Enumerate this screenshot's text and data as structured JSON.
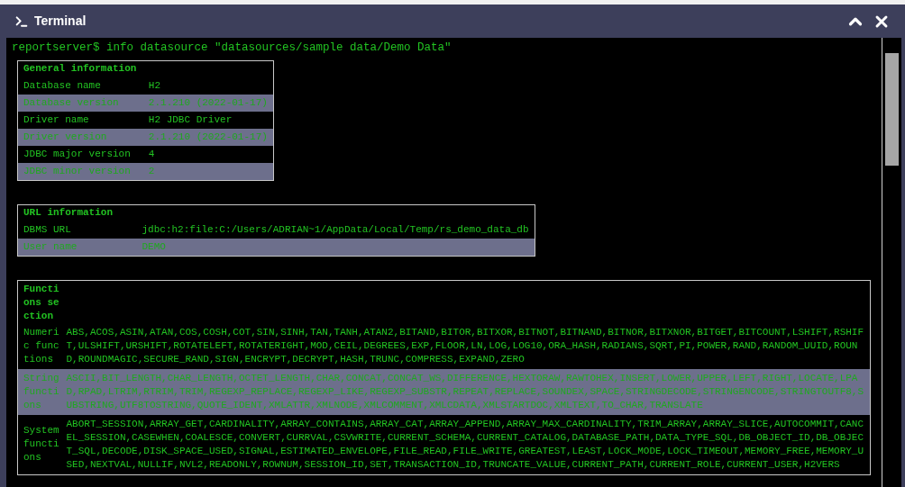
{
  "window": {
    "title": "Terminal"
  },
  "command": "reportserver$ info datasource \"datasources/sample data/Demo Data\"",
  "tables": [
    {
      "title": "General information",
      "rows": [
        {
          "label": "Database name",
          "value": "H2",
          "highlighted": false
        },
        {
          "label": "Database version",
          "value": "2.1.210 (2022-01-17)",
          "highlighted": true
        },
        {
          "label": "Driver name",
          "value": "H2 JDBC Driver",
          "highlighted": false
        },
        {
          "label": "Driver version",
          "value": "2.1.210 (2022-01-17)",
          "highlighted": true
        },
        {
          "label": "JDBC major version",
          "value": "4",
          "highlighted": false
        },
        {
          "label": "JDBC minor version",
          "value": "2",
          "highlighted": true
        }
      ]
    },
    {
      "title": "URL information",
      "rows": [
        {
          "label": "DBMS URL",
          "value": "jdbc:h2:file:C:/Users/ADRIAN~1/AppData/Local/Temp/rs_demo_data_db",
          "highlighted": false
        },
        {
          "label": "User name",
          "value": "DEMO",
          "highlighted": true
        }
      ]
    }
  ],
  "functions_table": {
    "title": "Functions section",
    "rows": [
      {
        "label": "Numeric functions",
        "value": "ABS,ACOS,ASIN,ATAN,COS,COSH,COT,SIN,SINH,TAN,TANH,ATAN2,BITAND,BITOR,BITXOR,BITNOT,BITNAND,BITNOR,BITXNOR,BITGET,BITCOUNT,LSHIFT,RSHIFT,ULSHIFT,URSHIFT,ROTATELEFT,ROTATERIGHT,MOD,CEIL,DEGREES,EXP,FLOOR,LN,LOG,LOG10,ORA_HASH,RADIANS,SQRT,PI,POWER,RAND,RANDOM_UUID,ROUND,ROUNDMAGIC,SECURE_RAND,SIGN,ENCRYPT,DECRYPT,HASH,TRUNC,COMPRESS,EXPAND,ZERO",
        "highlighted": false
      },
      {
        "label": "String functions",
        "value": "ASCII,BIT_LENGTH,CHAR_LENGTH,OCTET_LENGTH,CHAR,CONCAT,CONCAT_WS,DIFFERENCE,HEXTORAW,RAWTOHEX,INSERT,LOWER,UPPER,LEFT,RIGHT,LOCATE,LPAD,RPAD,LTRIM,RTRIM,TRIM,REGEXP_REPLACE,REGEXP_LIKE,REGEXP_SUBSTR,REPEAT,REPLACE,SOUNDEX,SPACE,STRINGDECODE,STRINGENCODE,STRINGTOUTF8,SUBSTRING,UTF8TOSTRING,QUOTE_IDENT,XMLATTR,XMLNODE,XMLCOMMENT,XMLCDATA,XMLSTARTDOC,XMLTEXT,TO_CHAR,TRANSLATE",
        "highlighted": true
      },
      {
        "label": "System functions",
        "value": "ABORT_SESSION,ARRAY_GET,CARDINALITY,ARRAY_CONTAINS,ARRAY_CAT,ARRAY_APPEND,ARRAY_MAX_CARDINALITY,TRIM_ARRAY,ARRAY_SLICE,AUTOCOMMIT,CANCEL_SESSION,CASEWHEN,COALESCE,CONVERT,CURRVAL,CSVWRITE,CURRENT_SCHEMA,CURRENT_CATALOG,DATABASE_PATH,DATA_TYPE_SQL,DB_OBJECT_ID,DB_OBJECT_SQL,DECODE,DISK_SPACE_USED,SIGNAL,ESTIMATED_ENVELOPE,FILE_READ,FILE_WRITE,GREATEST,LEAST,LOCK_MODE,LOCK_TIMEOUT,MEMORY_FREE,MEMORY_USED,NEXTVAL,NULLIF,NVL2,READONLY,ROWNUM,SESSION_ID,SET,TRANSACTION_ID,TRUNCATE_VALUE,CURRENT_PATH,CURRENT_ROLE,CURRENT_USER,H2VERS",
        "highlighted": false
      }
    ]
  }
}
